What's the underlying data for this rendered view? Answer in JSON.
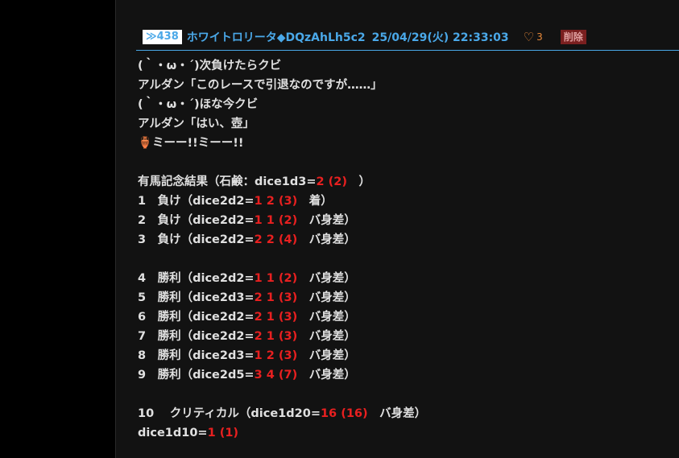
{
  "post": {
    "number": "≫438",
    "name": "ホワイトロリータ◆DQzAhLh5c2",
    "date": "25/04/29(火) 22:33:03",
    "likes": "3",
    "delete_label": "削除"
  },
  "body": {
    "l1": "(｀・ω・´)次負けたらクビ",
    "l2": "アルダン「このレースで引退なのですが……」",
    "l3": "(｀・ω・´)ほな今クビ",
    "l4": "アルダン「はい、壺」",
    "l5_icon": "🏺",
    "l5_text": "ミーー!!ミーー!!",
    "result_prefix": "有馬記念結果（石鹸：dice1d3=",
    "result_roll": "2 (2)",
    "result_suffix": "　）",
    "rows": [
      {
        "no": "1",
        "label": "負け",
        "dice": "dice2d2=",
        "roll": "1 2 (3)",
        "suffix": "着）"
      },
      {
        "no": "2",
        "label": "負け",
        "dice": "dice2d2=",
        "roll": "1 1 (2)",
        "suffix": "バ身差）"
      },
      {
        "no": "3",
        "label": "負け",
        "dice": "dice2d2=",
        "roll": "2 2 (4)",
        "suffix": "バ身差）"
      },
      {
        "no": "4",
        "label": "勝利",
        "dice": "dice2d2=",
        "roll": "1 1 (2)",
        "suffix": "バ身差）"
      },
      {
        "no": "5",
        "label": "勝利",
        "dice": "dice2d3=",
        "roll": "2 1 (3)",
        "suffix": "バ身差）"
      },
      {
        "no": "6",
        "label": "勝利",
        "dice": "dice2d2=",
        "roll": "2 1 (3)",
        "suffix": "バ身差）"
      },
      {
        "no": "7",
        "label": "勝利",
        "dice": "dice2d2=",
        "roll": "2 1 (3)",
        "suffix": "バ身差）"
      },
      {
        "no": "8",
        "label": "勝利",
        "dice": "dice2d3=",
        "roll": "1 2 (3)",
        "suffix": "バ身差）"
      },
      {
        "no": "9",
        "label": "勝利",
        "dice": "dice2d5=",
        "roll": "3 4 (7)",
        "suffix": "バ身差）"
      },
      {
        "no": "10",
        "label": "クリティカル",
        "dice": "dice1d20=",
        "roll": "16 (16)",
        "suffix": "バ身差）"
      }
    ],
    "final_dice": "dice1d10=",
    "final_roll": "1 (1)"
  },
  "colors": {
    "accent": "#4aa8e8",
    "dice_result": "#e82020",
    "like": "#e8893a",
    "delete_bg": "#7a1f1f"
  }
}
